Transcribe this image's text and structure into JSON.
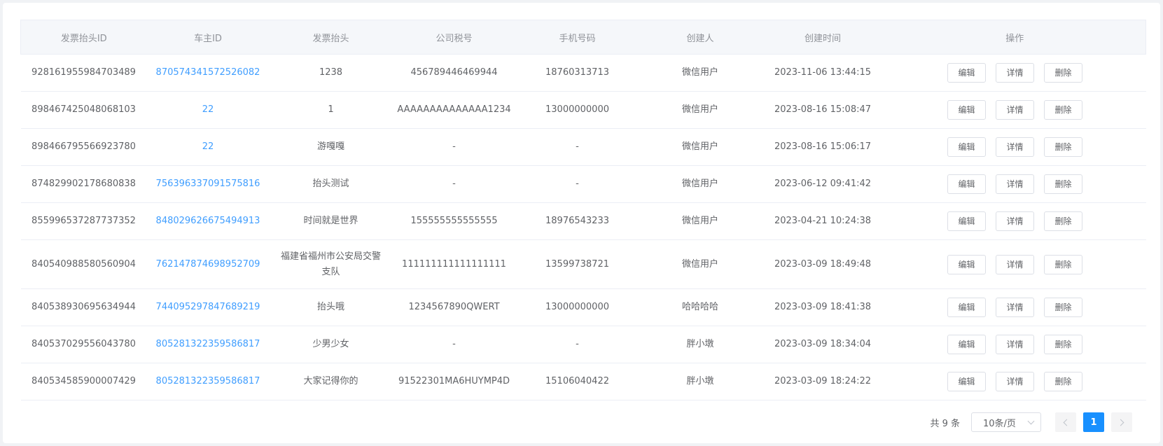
{
  "table": {
    "columns": [
      "发票抬头ID",
      "车主ID",
      "发票抬头",
      "公司税号",
      "手机号码",
      "创建人",
      "创建时间",
      "操作"
    ],
    "actions": {
      "edit": "编辑",
      "detail": "详情",
      "delete": "删除"
    },
    "rows": [
      {
        "id": "928161955984703489",
        "owner_id": "870574341572526082",
        "title": "1238",
        "tax_no": "456789446469944",
        "phone": "18760313713",
        "creator": "微信用户",
        "created": "2023-11-06 13:44:15"
      },
      {
        "id": "898467425048068103",
        "owner_id": "22",
        "title": "1",
        "tax_no": "AAAAAAAAAAAAAA1234",
        "phone": "13000000000",
        "creator": "微信用户",
        "created": "2023-08-16 15:08:47"
      },
      {
        "id": "898466795566923780",
        "owner_id": "22",
        "title": "游嘎嘎",
        "tax_no": "-",
        "phone": "-",
        "creator": "微信用户",
        "created": "2023-08-16 15:06:17"
      },
      {
        "id": "874829902178680838",
        "owner_id": "756396337091575816",
        "title": "抬头测试",
        "tax_no": "-",
        "phone": "-",
        "creator": "微信用户",
        "created": "2023-06-12 09:41:42"
      },
      {
        "id": "855996537287737352",
        "owner_id": "848029626675494913",
        "title": "时间就是世界",
        "tax_no": "155555555555555",
        "phone": "18976543233",
        "creator": "微信用户",
        "created": "2023-04-21 10:24:38"
      },
      {
        "id": "840540988580560904",
        "owner_id": "762147874698952709",
        "title": "福建省福州市公安局交警支队",
        "tax_no": "111111111111111111",
        "phone": "13599738721",
        "creator": "微信用户",
        "created": "2023-03-09 18:49:48"
      },
      {
        "id": "840538930695634944",
        "owner_id": "744095297847689219",
        "title": "抬头哦",
        "tax_no": "1234567890QWERT",
        "phone": "13000000000",
        "creator": "哈哈哈哈",
        "created": "2023-03-09 18:41:38"
      },
      {
        "id": "840537029556043780",
        "owner_id": "805281322359586817",
        "title": "少男少女",
        "tax_no": "-",
        "phone": "-",
        "creator": "胖小墩",
        "created": "2023-03-09 18:34:04"
      },
      {
        "id": "840534585900007429",
        "owner_id": "805281322359586817",
        "title": "大家记得你的",
        "tax_no": "91522301MA6HUYMP4D",
        "phone": "15106040422",
        "creator": "胖小墩",
        "created": "2023-03-09 18:24:22"
      }
    ]
  },
  "pagination": {
    "total_text": "共 9 条",
    "page_size": "10条/页",
    "current_page": "1"
  }
}
